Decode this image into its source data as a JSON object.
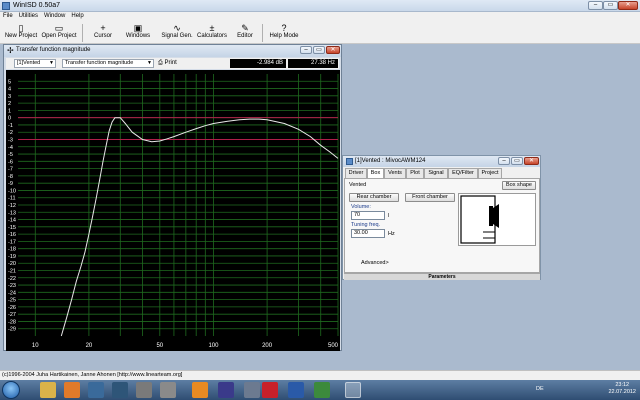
{
  "app": {
    "title": "WinISD 0.50a7"
  },
  "menu": [
    "File",
    "Utilities",
    "Window",
    "Help"
  ],
  "toolbar": {
    "buttons": [
      {
        "label": "New Project",
        "icon": "new-project-icon",
        "glyph": "▯"
      },
      {
        "label": "Open Project",
        "icon": "open-project-icon",
        "glyph": "▭"
      },
      {
        "label": "Cursor",
        "icon": "cursor-icon",
        "glyph": "+"
      },
      {
        "label": "Windows",
        "icon": "windows-icon",
        "glyph": "▣"
      },
      {
        "label": "Signal Gen.",
        "icon": "signal-gen-icon",
        "glyph": "∿"
      },
      {
        "label": "Calculators",
        "icon": "calculator-icon",
        "glyph": "±"
      },
      {
        "label": "Editor",
        "icon": "editor-icon",
        "glyph": "✎"
      },
      {
        "label": "Help Mode",
        "icon": "help-icon",
        "glyph": "?"
      }
    ]
  },
  "graph_window": {
    "title": "Transfer function magnitude",
    "project_combo": "[1]Vented",
    "graph_combo": "Transfer function magnitude",
    "print_label": "Print",
    "readout_db": "-2.984 dB",
    "readout_hz": "27.38 Hz"
  },
  "dialog": {
    "title": "[1]Vented : MivocAWM124",
    "tabs": [
      "Driver",
      "Box",
      "Vents",
      "Plot",
      "Signal",
      "EQ/Filter",
      "Project"
    ],
    "active_tab": "Box",
    "type_label": "Vented",
    "box_shape_button": "Box shape",
    "rear_chamber_button": "Rear chamber",
    "front_chamber_button": "Front chamber",
    "volume_label": "Volume:",
    "volume_value": "70",
    "volume_unit": "l",
    "tuning_label": "Tuning freq.",
    "tuning_value": "30.00",
    "tuning_unit": "Hz",
    "advanced_label": "Advanced>",
    "parameters_label": "Parameters"
  },
  "statusbar": {
    "text": "(c)1996-2004 Juha Hartikainen, Janne Ahonen [http://www.linearteam.org]"
  },
  "taskbar": {
    "language": "DE",
    "time": "23:12",
    "date": "22.07.2012",
    "apps": [
      "explorer-icon",
      "media-player-icon",
      "vlc-icon",
      "steam-icon",
      "firefox-icon",
      "save-icon",
      "audio-icon",
      "pdf-icon",
      "word-icon",
      "image-icon",
      "winisd-icon"
    ]
  },
  "chart_data": {
    "type": "line",
    "title": "",
    "xlabel": "",
    "ylabel": "",
    "x_scale": "log",
    "xlim": [
      8,
      500
    ],
    "ylim": [
      -30,
      6
    ],
    "y_ticks": [
      5,
      4,
      3,
      2,
      1,
      0,
      -1,
      -2,
      -3,
      -4,
      -5,
      -6,
      -7,
      -8,
      -9,
      -10,
      -11,
      -12,
      -13,
      -14,
      -15,
      -16,
      -17,
      -18,
      -19,
      -20,
      -21,
      -22,
      -23,
      -24,
      -25,
      -26,
      -27,
      -28,
      -29
    ],
    "x_tick_labels": [
      {
        "x": 10,
        "label": "10"
      },
      {
        "x": 20,
        "label": "20"
      },
      {
        "x": 50,
        "label": "50"
      },
      {
        "x": 100,
        "label": "100"
      },
      {
        "x": 200,
        "label": "200"
      },
      {
        "x": 500,
        "label": "500"
      }
    ],
    "x_grid": [
      10,
      20,
      30,
      40,
      50,
      60,
      70,
      80,
      90,
      100,
      200,
      300,
      400,
      500
    ],
    "reference_lines": [
      0,
      -3
    ],
    "grid": true,
    "series": [
      {
        "color": "#e8e8e8",
        "x": [
          14,
          15,
          16,
          17,
          18,
          19,
          20,
          21,
          22,
          23,
          24,
          25,
          26,
          27,
          28,
          30,
          32,
          35,
          40,
          45,
          50,
          55,
          60,
          70,
          80,
          90,
          100,
          120,
          140,
          160,
          180,
          200,
          250,
          300,
          350,
          400,
          450,
          500
        ],
        "y": [
          -30,
          -27.5,
          -25,
          -22.5,
          -20.5,
          -18.5,
          -16,
          -13.5,
          -11,
          -8.5,
          -6,
          -3.8,
          -1.8,
          -0.6,
          0,
          0,
          -0.8,
          -2.0,
          -3.0,
          -3.3,
          -3.2,
          -2.9,
          -2.6,
          -2.0,
          -1.5,
          -1.1,
          -0.8,
          -0.5,
          -0.3,
          -0.2,
          -0.2,
          -0.3,
          -0.8,
          -1.6,
          -2.6,
          -3.8,
          -4.7,
          -5.6
        ]
      }
    ]
  }
}
